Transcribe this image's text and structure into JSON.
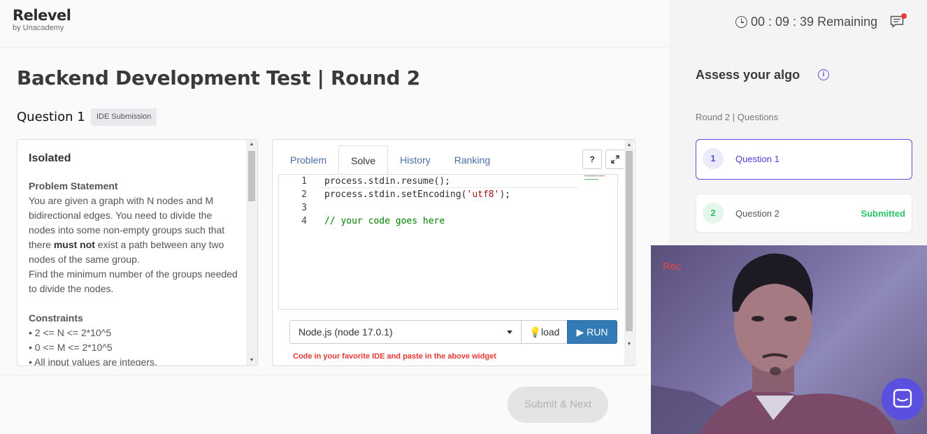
{
  "header": {
    "logo_title": "Relevel",
    "logo_sub": "by Unacademy",
    "timer": "00 : 09 : 39 Remaining"
  },
  "page_title": "Backend Development Test | Round 2",
  "question": {
    "label": "Question 1",
    "badge": "IDE Submission"
  },
  "problem": {
    "title": "Isolated",
    "statement_heading": "Problem Statement",
    "statement_part1": "You are given a graph with N nodes and M bidirectional edges. You need to divide the nodes into some non-empty groups such that there ",
    "statement_bold": "must not",
    "statement_part2": " exist a path between any two nodes of the same group.",
    "statement_line2": "Find the minimum number of the groups needed to divide the nodes.",
    "constraints_heading": "Constraints",
    "constraints": [
      "• 2 <= N <= 2*10^5",
      "• 0 <= M <= 2*10^5",
      "• All input values are integers."
    ]
  },
  "editor": {
    "tabs": [
      "Problem",
      "Solve",
      "History",
      "Ranking"
    ],
    "active_tab": "Solve",
    "help_label": "?",
    "code": {
      "line1_num": "1",
      "line1_code": "process.stdin.resume();",
      "line2_num": "2",
      "line2_pre": "process.stdin.setEncoding(",
      "line2_str": "'utf8'",
      "line2_post": ");",
      "line3_num": "3",
      "line4_num": "4",
      "line4_comment": "// your code goes here"
    },
    "language": "Node.js (node 17.0.1)",
    "load_label": "load",
    "run_label": "RUN",
    "hint": "Code in your favorite IDE and paste in the above widget"
  },
  "submit_label": "Submit & Next",
  "sidebar": {
    "title": "Assess your algo",
    "info_label": "i",
    "round_label": "Round 2 | Questions",
    "questions": [
      {
        "num": "1",
        "name": "Question 1",
        "status": ""
      },
      {
        "num": "2",
        "name": "Question 2",
        "status": "Submitted"
      }
    ]
  },
  "webcam": {
    "rec_label": "Rec"
  },
  "colors": {
    "accent": "#5b4fe0",
    "run_button": "#337ab7",
    "submitted": "#2ec26a",
    "hint": "#e53935"
  }
}
